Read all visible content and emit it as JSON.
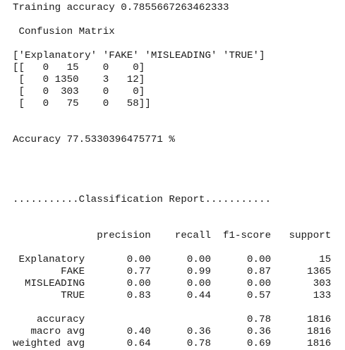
{
  "output": {
    "lines": [
      "Training accuracy 0.7855667263462333",
      "",
      " Confusion Matrix",
      "",
      "['Explanatory' 'FAKE' 'MISLEADING' 'TRUE']",
      "[[   0   15    0    0]",
      " [   0 1350    3   12]",
      " [   0  303    0    0]",
      " [   0   75    0   58]]",
      "",
      "",
      "Accuracy 77.5330396475771 %",
      "",
      "",
      "",
      "",
      "...........Classification Report...........",
      "",
      "",
      "              precision    recall  f1-score   support",
      "",
      " Explanatory       0.00      0.00      0.00        15",
      "        FAKE       0.77      0.99      0.87      1365",
      "  MISLEADING       0.00      0.00      0.00       303",
      "        TRUE       0.83      0.44      0.57       133",
      "",
      "    accuracy                           0.78      1816",
      "   macro avg       0.40      0.36      0.36      1816",
      "weighted avg       0.64      0.78      0.69      1816"
    ]
  }
}
